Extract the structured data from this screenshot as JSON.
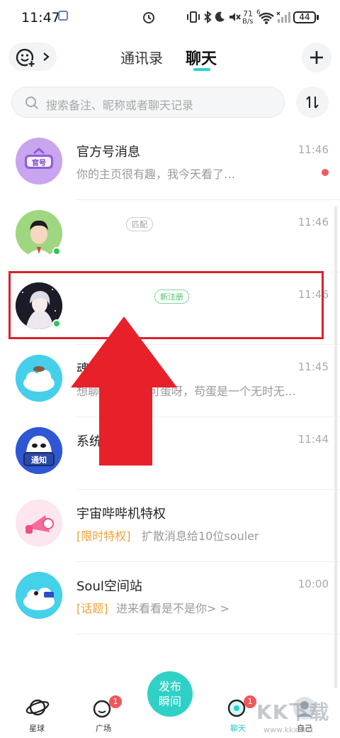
{
  "status_bar": {
    "time": "11:47",
    "net_speed_top": "71",
    "net_speed_bottom": "B/s",
    "signal_label": "6",
    "battery": "44"
  },
  "header": {
    "tab_contacts": "通讯录",
    "tab_chat": "聊天"
  },
  "search": {
    "placeholder": "搜索备注、昵称或者聊天记录"
  },
  "chats": [
    {
      "name": "官方号消息",
      "preview": "你的主页很有趣，我今天看了…",
      "time": "11:46",
      "avatar_label": "官号",
      "unread": true
    },
    {
      "name": "",
      "tag": "匹配",
      "preview": "",
      "time": "11:46",
      "online": true
    },
    {
      "name": "",
      "tag": "新注册",
      "preview": "",
      "time": "11:46",
      "online": true
    },
    {
      "name": "魂淡",
      "preview": "想聊…",
      "preview_rest": "可蛋呀，苟蛋是一个无时无…",
      "time": "11:45"
    },
    {
      "name": "系统",
      "preview": "",
      "time": "11:44",
      "avatar_label": "通知"
    },
    {
      "name": "宇宙哔哔机特权",
      "preview_tag": "[限时特权]",
      "preview": "扩散消息给10位souler",
      "time": ""
    },
    {
      "name": "Soul空间站",
      "preview_tag": "[话题]",
      "preview": "进来看看是不是你> >",
      "time": "10:00"
    }
  ],
  "bottom_nav": {
    "planet": "星球",
    "square": "广场",
    "square_badge": "1",
    "publish": "发布瞬间",
    "publish_line1": "发布",
    "publish_line2": "瞬间",
    "chat": "聊天",
    "chat_badge": "1",
    "me": "自己"
  },
  "watermark": {
    "text": "KK下载",
    "url": "www.kkx.net"
  },
  "colors": {
    "accent": "#25d4d0",
    "highlight_box": "#d8232a",
    "arrow": "#e8202a",
    "tag_orange": "#f0a23a"
  }
}
